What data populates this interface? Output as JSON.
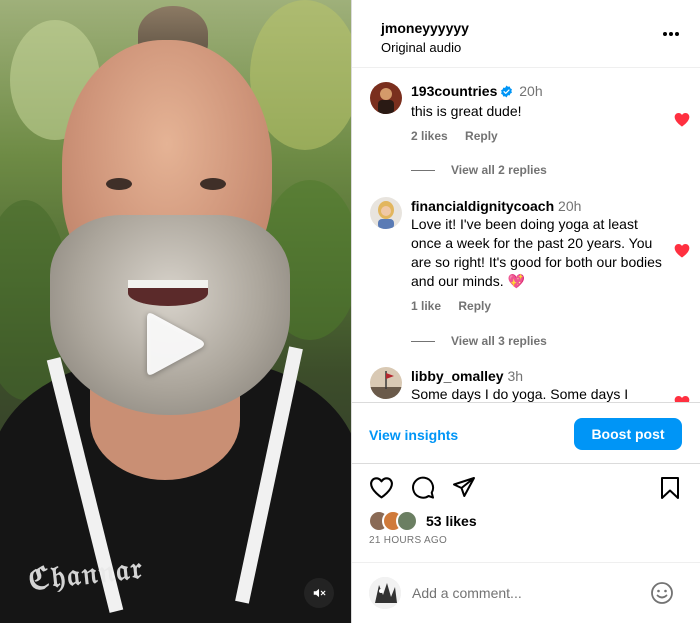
{
  "post": {
    "username": "jmoneyyyyyy",
    "audio": "Original audio"
  },
  "comments": [
    {
      "user": "193countries",
      "verified": true,
      "time": "20h",
      "text": "this is great dude!",
      "likes": "2 likes",
      "reply": "Reply",
      "view_replies": "View all 2 replies",
      "liked": true
    },
    {
      "user": "financialdignitycoach",
      "verified": false,
      "time": "20h",
      "text": "Love it! I've been doing yoga at least once a week for the past 20 years. You are so right! It's good for both our bodies and our minds. 💖",
      "likes": "1 like",
      "reply": "Reply",
      "view_replies": "View all 3 replies",
      "liked": true
    },
    {
      "user": "libby_omalley",
      "verified": false,
      "time": "3h",
      "text": "Some days I do yoga. Some days I",
      "liked": true
    }
  ],
  "insights": {
    "view_label": "View insights",
    "boost_label": "Boost post"
  },
  "engagement": {
    "likes": "53 likes",
    "timestamp": "21 HOURS AGO"
  },
  "composer": {
    "placeholder": "Add a comment..."
  },
  "icons": {
    "more": "more-horizontal-icon",
    "verified": "verified-badge-icon",
    "heart_filled": "heart-filled-icon",
    "like": "heart-outline-icon",
    "comment": "comment-icon",
    "share": "send-icon",
    "save": "bookmark-icon",
    "play": "play-icon",
    "mute": "volume-muted-icon",
    "emoji": "emoji-icon"
  },
  "colors": {
    "accent": "#0095f6",
    "heart": "#ff3040",
    "muted_text": "#737373",
    "border": "#dbdbdb"
  }
}
